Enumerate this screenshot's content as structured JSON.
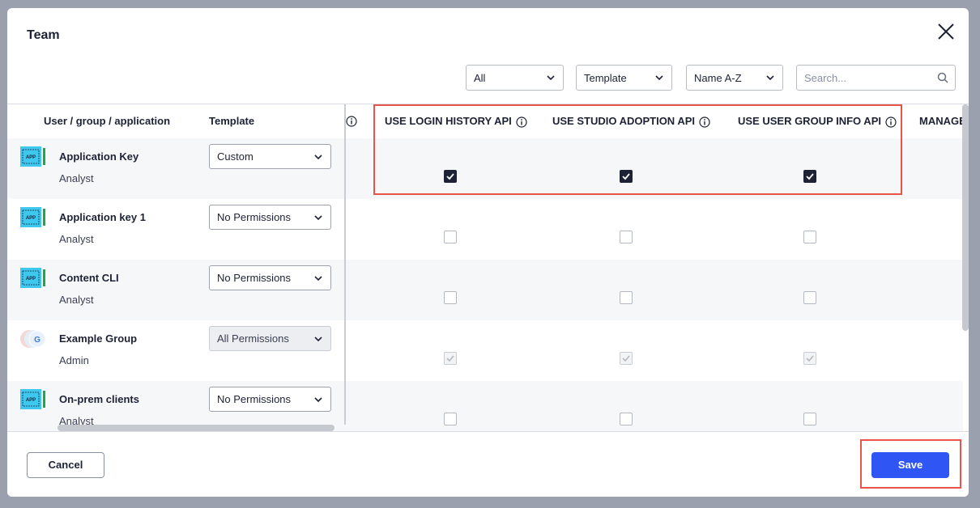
{
  "modal": {
    "title": "Team"
  },
  "filters": {
    "scope": {
      "selected": "All"
    },
    "template": {
      "selected": "Template"
    },
    "sort": {
      "selected": "Name A-Z"
    },
    "search": {
      "placeholder": "Search..."
    }
  },
  "table": {
    "headers": {
      "entity": "User / group / application",
      "template": "Template",
      "perm1": "USE LOGIN HISTORY API",
      "perm2": "USE STUDIO ADOPTION API",
      "perm3": "USE USER GROUP INFO API",
      "perm4": "MANAGE"
    },
    "rows": [
      {
        "name": "Application Key",
        "role": "Analyst",
        "icon": "app-icon",
        "template": "Custom",
        "perms": [
          "checked",
          "checked",
          "checked"
        ]
      },
      {
        "name": "Application key 1",
        "role": "Analyst",
        "icon": "app-icon",
        "template": "No Permissions",
        "perms": [
          "unchecked",
          "unchecked",
          "unchecked"
        ]
      },
      {
        "name": "Content CLI",
        "role": "Analyst",
        "icon": "app-icon",
        "template": "No Permissions",
        "perms": [
          "unchecked",
          "unchecked",
          "unchecked"
        ]
      },
      {
        "name": "Example Group",
        "role": "Admin",
        "icon": "group-avatar-icon",
        "avatar_letter": "G",
        "template": "All Permissions",
        "perms": [
          "disabled-checked",
          "disabled-checked",
          "disabled-checked"
        ]
      },
      {
        "name": "On-prem clients",
        "role": "Analyst",
        "icon": "app-icon",
        "template": "No Permissions",
        "perms": [
          "unchecked",
          "unchecked",
          "unchecked"
        ]
      }
    ]
  },
  "icon_text": {
    "app": "APP"
  },
  "footer": {
    "cancel_label": "Cancel",
    "save_label": "Save"
  },
  "colors": {
    "primary": "#2f55f5",
    "highlight": "#e9534a",
    "text": "#1d2235"
  }
}
